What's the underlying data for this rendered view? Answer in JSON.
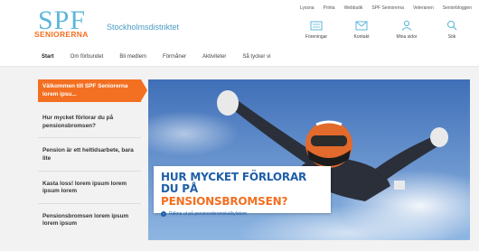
{
  "header": {
    "logo_main": "SPF",
    "logo_sub": "SENIORERNA",
    "district": "Stockholmsdistriktet",
    "top_links": [
      "Lyssna",
      "Printa",
      "Webbutik",
      "SPF Seniorerna",
      "Veteranen",
      "Seniorbloggen"
    ],
    "icons": [
      {
        "label": "Föreningar",
        "icon": "building-icon"
      },
      {
        "label": "Kontakt",
        "icon": "mail-icon"
      },
      {
        "label": "Mina sidor",
        "icon": "user-icon"
      },
      {
        "label": "Sök",
        "icon": "search-icon"
      }
    ]
  },
  "nav": {
    "items": [
      "Start",
      "Om förbundet",
      "Bli medlem",
      "Förmåner",
      "Aktiviteter",
      "Så tycker vi"
    ],
    "active_index": 0
  },
  "sidebar": {
    "items": [
      "Välkommen till SPF Seniorerna lorem ipsu...",
      "Hur mycket förlorar du på pensionsbromsen?",
      "Pension är ett heltidsarbete, bara lite",
      "Kasta loss! lorem ipsum lorem ipsum lorem",
      "Pensionsbromsen lorem ipsum lorem ipsum"
    ],
    "active_index": 0
  },
  "hero": {
    "headline_blue": "HUR MYCKET FÖRLORAR DU PÅ",
    "headline_orange": "PENSIONSBROMSEN?",
    "link_text": "Räkna ut på pensionsbromskalkylatorn"
  },
  "colors": {
    "brand_orange": "#f36f21",
    "brand_blue": "#1f5fa8",
    "logo_blue": "#5db7d9"
  }
}
